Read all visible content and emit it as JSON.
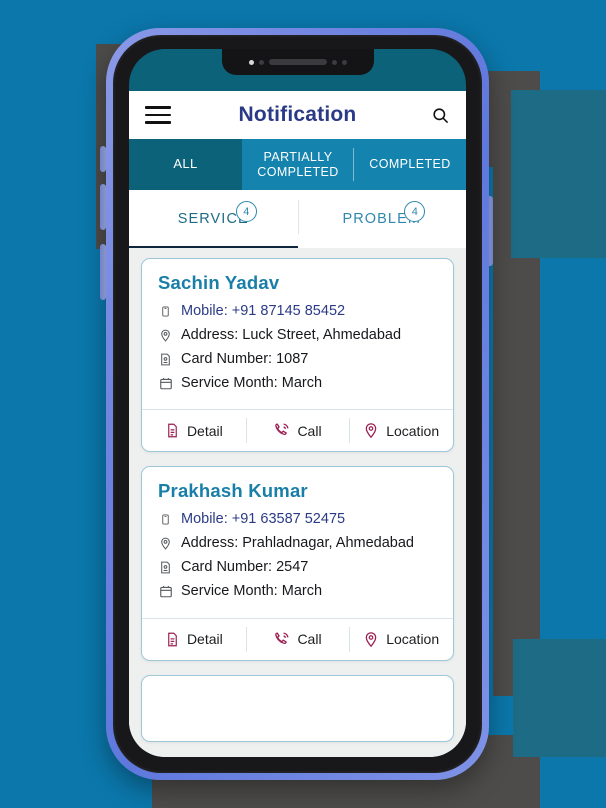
{
  "background": {
    "page_color": "#0b77ab",
    "accent_rect_color": "#1d6b85",
    "shadow_color": "#4d4c4b"
  },
  "phone": {
    "frame_color": "#6f83e0",
    "notch": {
      "elements": [
        "camera-dot",
        "sensor-dot",
        "speaker-grille",
        "sensor-dot",
        "sensor-dot"
      ]
    }
  },
  "appbar": {
    "menu_icon": "hamburger-menu-icon",
    "title": "Notification",
    "title_color": "#2b3a86",
    "search_icon": "search-icon"
  },
  "segments": {
    "active": "ALL",
    "active_color": "#0c6279",
    "inactive_color": "#1483ae",
    "items": [
      {
        "label": "ALL"
      },
      {
        "label": "PARTIALLY COMPLETED"
      },
      {
        "label": "COMPLETED"
      }
    ]
  },
  "subtabs": {
    "active_index": 0,
    "accent_color": "#2f88ae",
    "underline_color": "#10263f",
    "items": [
      {
        "label": "SERVICE",
        "badge": "4"
      },
      {
        "label": "PROBLEM",
        "badge": "4"
      }
    ]
  },
  "labels": {
    "mobile_prefix": "Mobile: ",
    "address_prefix": "Address: ",
    "card_number_prefix": "Card Number: ",
    "service_month_prefix": "Service Month: "
  },
  "actions": {
    "icon_color": "#9b1f51",
    "items": [
      {
        "label": "Detail",
        "icon": "document-icon"
      },
      {
        "label": "Call",
        "icon": "phone-ringing-icon"
      },
      {
        "label": "Location",
        "icon": "location-pin-icon"
      }
    ]
  },
  "cards": [
    {
      "name": "Sachin Yadav",
      "name_color": "#1a7fa8",
      "mobile": "Mobile: +91 87145 85452",
      "address": "Address: Luck Street, Ahmedabad",
      "card_number": "Card Number: 1087",
      "service_month": "Service Month: March"
    },
    {
      "name": "Prakhash Kumar",
      "name_color": "#1a7fa8",
      "mobile": "Mobile: +91 63587 52475",
      "address": "Address: Prahladnagar, Ahmedabad",
      "card_number": "Card Number: 2547",
      "service_month": "Service Month: March"
    }
  ]
}
